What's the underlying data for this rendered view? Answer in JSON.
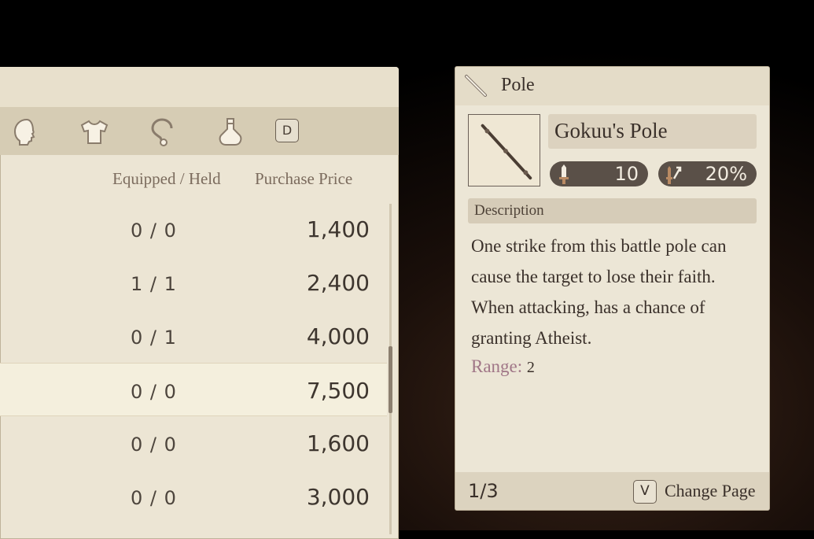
{
  "shop": {
    "tab_key": "D",
    "col_equipped": "Equipped / Held",
    "col_price": "Purchase Price",
    "rows": [
      {
        "equipped": "0 / 0",
        "price": "1,400"
      },
      {
        "equipped": "1 / 1",
        "price": "2,400"
      },
      {
        "equipped": "0 / 1",
        "price": "4,000"
      },
      {
        "equipped": "0 / 0",
        "price": "7,500"
      },
      {
        "equipped": "0 / 0",
        "price": "1,600"
      },
      {
        "equipped": "0 / 0",
        "price": "3,000"
      }
    ],
    "tab_icons": [
      "head-icon",
      "body-armor-icon",
      "accessory-icon",
      "potion-icon"
    ]
  },
  "info": {
    "category": "Pole",
    "category_icon": "pole-icon",
    "item_name": "Gokuu's Pole",
    "stats": [
      {
        "icon": "attack-icon",
        "value": "10"
      },
      {
        "icon": "evasion-icon",
        "value": "20%"
      }
    ],
    "description_header": "Description",
    "description": "One strike from this battle pole can cause the target to lose their faith. When attacking, has a chance of granting Atheist.",
    "range_label": "Range:",
    "range_value": "2",
    "page": "1/3",
    "change_key": "V",
    "change_label": "Change Page"
  },
  "colors": {
    "panel": "#ece5d4",
    "tab_bar": "#d6ccb4",
    "range_label": "#a07687",
    "stat_pill": "#5a5048"
  }
}
